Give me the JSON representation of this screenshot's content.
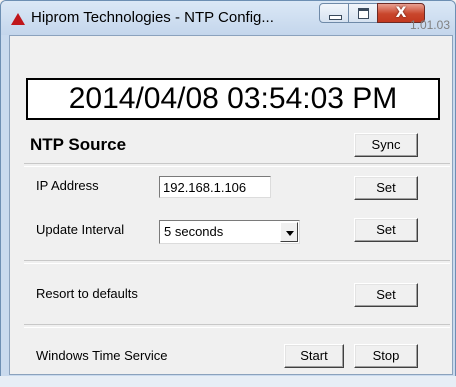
{
  "window": {
    "title": "Hiprom Technologies - NTP Config...",
    "close_symbol": "X",
    "version": "1.01.03",
    "icon": "red-triangle-app-icon"
  },
  "clock": {
    "datetime": "2014/04/08 03:54:03 PM"
  },
  "ntp_source": {
    "title": "NTP Source",
    "sync_label": "Sync"
  },
  "ip_address": {
    "label": "IP Address",
    "value": "192.168.1.106",
    "set_label": "Set"
  },
  "update_interval": {
    "label": "Update Interval",
    "selected": "5 seconds",
    "set_label": "Set"
  },
  "defaults": {
    "label": "Resort to defaults",
    "set_label": "Set"
  },
  "windows_time": {
    "label": "Windows Time Service",
    "start_label": "Start",
    "stop_label": "Stop"
  }
}
